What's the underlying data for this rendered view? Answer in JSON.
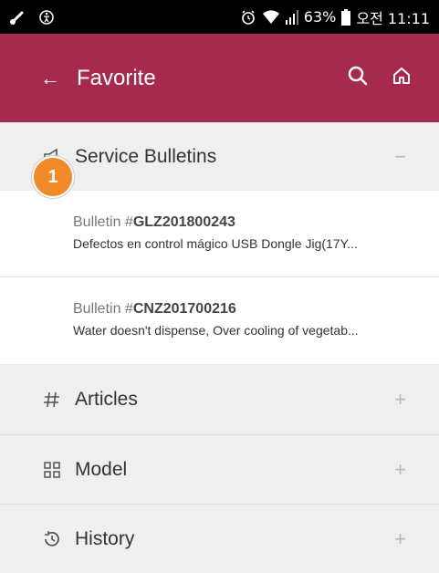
{
  "status_bar": {
    "right_text": "63%",
    "time": "오전 11:11",
    "icons": [
      "link-icon",
      "accessibility-icon",
      "alarm-icon",
      "wifi-icon",
      "signal-icon",
      "battery-icon"
    ]
  },
  "app_bar": {
    "title": "Favorite",
    "icons": [
      "back-arrow-icon",
      "search-icon",
      "home-icon"
    ],
    "color": "#a62a4d"
  },
  "sections": [
    {
      "label": "Service Bulletins",
      "toggle": "−"
    },
    {
      "label": "Articles",
      "toggle": "+"
    },
    {
      "label": "Model",
      "toggle": "+"
    },
    {
      "label": "History",
      "toggle": "+"
    }
  ],
  "bulletins": [
    {
      "prefix": "Bulletin #",
      "id": "GLZ201800243",
      "desc": "Defectos en control mágico USB Dongle Jig(17Y..."
    },
    {
      "prefix": "Bulletin #",
      "id": "CNZ201700216",
      "desc": "Water doesn't dispense, Over cooling of vegetab..."
    }
  ],
  "badge": {
    "number": "1",
    "color": "#f28a2a"
  }
}
